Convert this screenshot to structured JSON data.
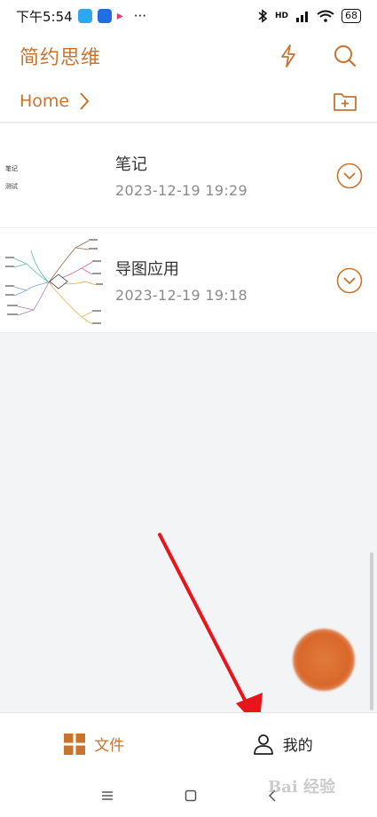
{
  "status": {
    "time": "下午5:54",
    "dots": "···",
    "network": "HD",
    "battery": "68"
  },
  "header": {
    "title": "简约思维"
  },
  "breadcrumb": {
    "home": "Home"
  },
  "files": [
    {
      "name": "笔记",
      "date": "2023-12-19 19:29",
      "thumb_lines": [
        "笔记",
        "测试"
      ]
    },
    {
      "name": "导图应用",
      "date": "2023-12-19 19:18"
    }
  ],
  "bottom_nav": {
    "files_label": "文件",
    "me_label": "我的"
  },
  "watermark": "Bai 经验",
  "colors": {
    "accent": "#c8742d",
    "annotation_arrow": "#e8151b"
  }
}
